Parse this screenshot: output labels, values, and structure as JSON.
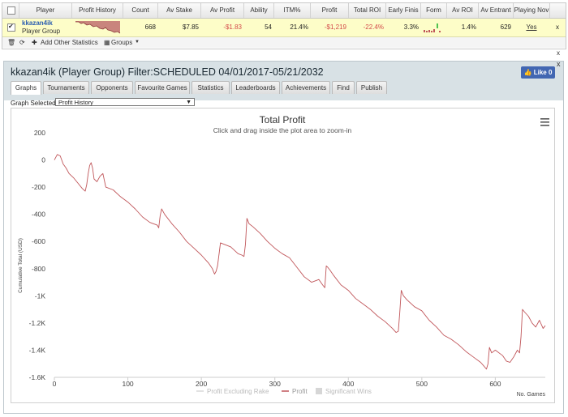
{
  "table": {
    "headers": [
      "Player",
      "Profit History",
      "Count",
      "Av Stake",
      "Av Profit",
      "Ability",
      "ITM%",
      "Profit",
      "Total ROI",
      "Early Finis",
      "Form",
      "Av ROI",
      "Av Entrant",
      "Playing Nov"
    ],
    "row": {
      "player_name": "kkazan4ik",
      "player_group": "Player Group",
      "count": "668",
      "av_stake": "$7.85",
      "av_profit": "-$1.83",
      "ability": "54",
      "itm": "21.4%",
      "profit": "-$1,219",
      "total_roi": "-22.4%",
      "early_finish": "3.3%",
      "av_roi": "1.4%",
      "av_entrant": "629",
      "playing_now": "Yes",
      "row_close": "x"
    },
    "toolbar": {
      "add_stats": "Add Other Statistics",
      "groups": "Groups"
    },
    "top_close": "x"
  },
  "panel": {
    "title": "kkazan4ik (Player Group) Filter:SCHEDULED 04/01/2017-05/21/2032",
    "like_label": "Like 0",
    "close": "x",
    "tabs": [
      "Graphs",
      "Tournaments",
      "Opponents",
      "Favourite Games",
      "Statistics",
      "Leaderboards",
      "Achievements",
      "Find",
      "Publish"
    ],
    "active_tab": "Graphs",
    "graph_selected_label": "Graph Selected:",
    "graph_selected_value": "Profit History"
  },
  "colors": {
    "profit_line": "#c0565a",
    "profit_excl_rake": "#d8d8d8",
    "significant_wins": "#cfcfcf",
    "neg_text": "#d34a4a",
    "like_button": "#4267b2"
  },
  "chart_data": {
    "type": "line",
    "title": "Total Profit",
    "subtitle": "Click and drag inside the plot area to zoom-in",
    "ylabel": "Cumulative Total (USD)",
    "xlabel": "No. Games",
    "xlim": [
      0,
      668
    ],
    "ylim": [
      -1600,
      200
    ],
    "x_ticks": [
      0,
      100,
      200,
      300,
      400,
      500,
      600
    ],
    "x_tick_labels": [
      "0",
      "100",
      "200",
      "300",
      "400",
      "500",
      "600"
    ],
    "y_ticks": [
      200,
      0,
      -200,
      -400,
      -600,
      -800,
      -1000,
      -1200,
      -1400,
      -1600
    ],
    "y_tick_labels": [
      "200",
      "0",
      "-200",
      "-400",
      "-600",
      "-800",
      "-1K",
      "-1.2K",
      "-1.4K",
      "-1.6K"
    ],
    "grid": false,
    "legend_position": "bottom-center",
    "legend": [
      "Profit Excluding Rake",
      "Profit",
      "Significant Wins"
    ],
    "series": [
      {
        "name": "Profit",
        "x": [
          0,
          4,
          8,
          12,
          16,
          20,
          26,
          32,
          38,
          42,
          44,
          46,
          48,
          50,
          52,
          54,
          58,
          62,
          66,
          70,
          80,
          90,
          100,
          110,
          120,
          130,
          140,
          142,
          144,
          146,
          150,
          160,
          170,
          180,
          190,
          200,
          210,
          215,
          218,
          220,
          222,
          226,
          240,
          250,
          255,
          258,
          260,
          262,
          265,
          270,
          280,
          290,
          300,
          310,
          320,
          330,
          340,
          350,
          360,
          365,
          368,
          370,
          372,
          375,
          380,
          390,
          400,
          410,
          420,
          430,
          440,
          450,
          460,
          465,
          468,
          470,
          472,
          475,
          480,
          490,
          500,
          510,
          520,
          530,
          540,
          550,
          560,
          570,
          580,
          585,
          588,
          590,
          592,
          595,
          600,
          610,
          615,
          620,
          625,
          630,
          633,
          635,
          637,
          640,
          645,
          650,
          655,
          660,
          665,
          668
        ],
        "y": [
          0,
          40,
          30,
          -30,
          -60,
          -100,
          -130,
          -170,
          -210,
          -230,
          -180,
          -100,
          -40,
          -20,
          -60,
          -140,
          -160,
          -120,
          -100,
          -200,
          -220,
          -270,
          -310,
          -360,
          -420,
          -460,
          -480,
          -500,
          -410,
          -360,
          -400,
          -470,
          -530,
          -600,
          -650,
          -700,
          -760,
          -800,
          -840,
          -820,
          -780,
          -610,
          -640,
          -690,
          -700,
          -710,
          -620,
          -430,
          -470,
          -490,
          -540,
          -600,
          -650,
          -690,
          -720,
          -790,
          -860,
          -900,
          -880,
          -920,
          -940,
          -780,
          -790,
          -810,
          -850,
          -920,
          -960,
          -1020,
          -1060,
          -1100,
          -1150,
          -1190,
          -1240,
          -1270,
          -1260,
          -1120,
          -960,
          -1000,
          -1030,
          -1080,
          -1110,
          -1180,
          -1230,
          -1290,
          -1320,
          -1360,
          -1410,
          -1450,
          -1490,
          -1520,
          -1540,
          -1500,
          -1380,
          -1420,
          -1400,
          -1440,
          -1480,
          -1490,
          -1450,
          -1400,
          -1420,
          -1300,
          -1100,
          -1120,
          -1150,
          -1200,
          -1230,
          -1180,
          -1240,
          -1220
        ]
      }
    ]
  }
}
